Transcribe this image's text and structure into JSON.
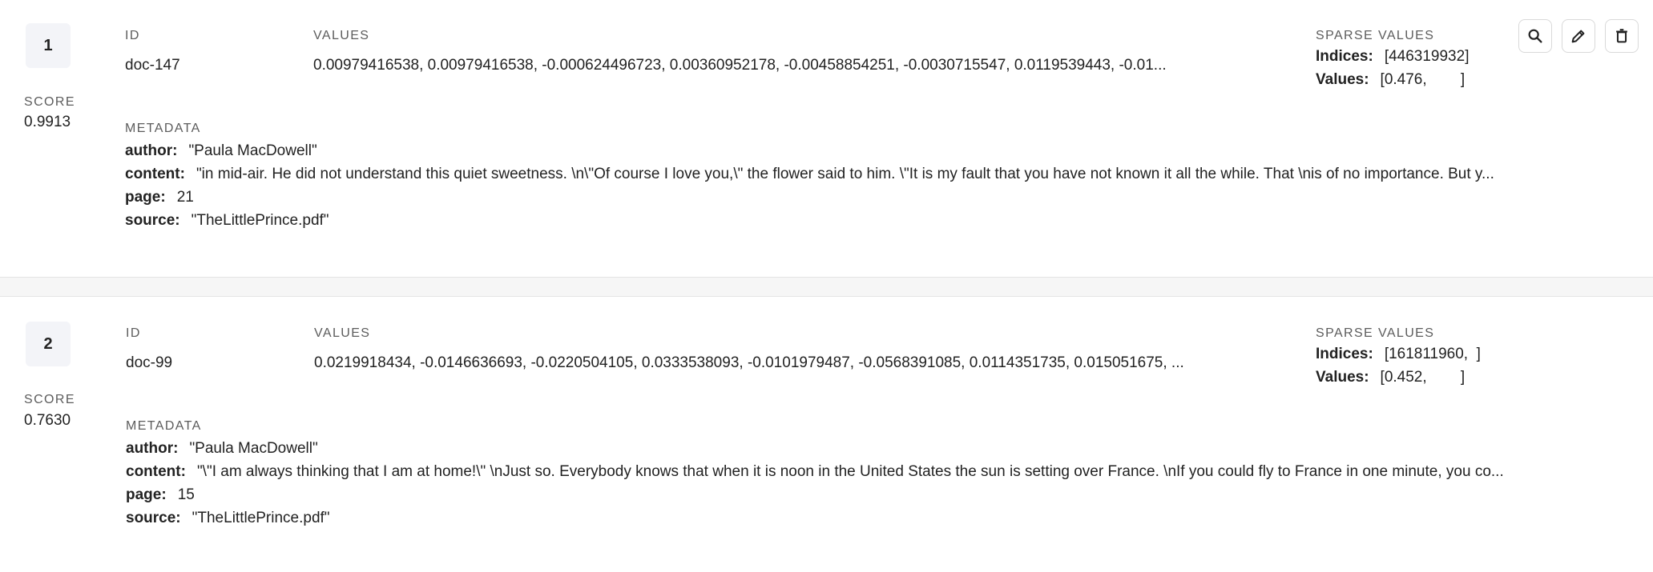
{
  "results": [
    {
      "rank": "1",
      "score_label": "SCORE",
      "score": "0.9913",
      "id_label": "ID",
      "id": "doc-147",
      "values_label": "VALUES",
      "values": "0.00979416538, 0.00979416538, -0.000624496723, 0.00360952178, -0.00458854251, -0.0030715547, 0.0119539443, -0.01...",
      "sparse_label": "SPARSE VALUES",
      "sparse_indices_key": "Indices:",
      "sparse_indices": "[446319932]",
      "sparse_values_key": "Values:",
      "sparse_values": "[0.476,        ]",
      "metadata_label": "METADATA",
      "metadata": [
        {
          "key": "author:",
          "value": "\"Paula MacDowell\""
        },
        {
          "key": "content:",
          "value": "\"in mid-air. He did not understand this quiet sweetness. \\n\\\"Of course I love you,\\\" the flower said to him. \\\"It is my fault that you have not known it all the while. That \\nis of no importance. But y..."
        },
        {
          "key": "page:",
          "value": "21"
        },
        {
          "key": "source:",
          "value": "\"TheLittlePrince.pdf\""
        }
      ]
    },
    {
      "rank": "2",
      "score_label": "SCORE",
      "score": "0.7630",
      "id_label": "ID",
      "id": "doc-99",
      "values_label": "VALUES",
      "values": "0.0219918434, -0.0146636693, -0.0220504105, 0.0333538093, -0.0101979487, -0.0568391085, 0.0114351735, 0.015051675, ...",
      "sparse_label": "SPARSE VALUES",
      "sparse_indices_key": "Indices:",
      "sparse_indices": "[161811960,  ]",
      "sparse_values_key": "Values:",
      "sparse_values": "[0.452,        ]",
      "metadata_label": "METADATA",
      "metadata": [
        {
          "key": "author:",
          "value": "\"Paula MacDowell\""
        },
        {
          "key": "content:",
          "value": "\"\\\"I am always thinking that I am at home!\\\" \\nJust so. Everybody knows that when it is noon in the United States the sun is setting over France. \\nIf you could fly to France in one minute, you co..."
        },
        {
          "key": "page:",
          "value": "15"
        },
        {
          "key": "source:",
          "value": "\"TheLittlePrince.pdf\""
        }
      ]
    }
  ],
  "actions": {
    "icons": [
      "search-icon",
      "pencil-icon",
      "trash-icon"
    ]
  }
}
